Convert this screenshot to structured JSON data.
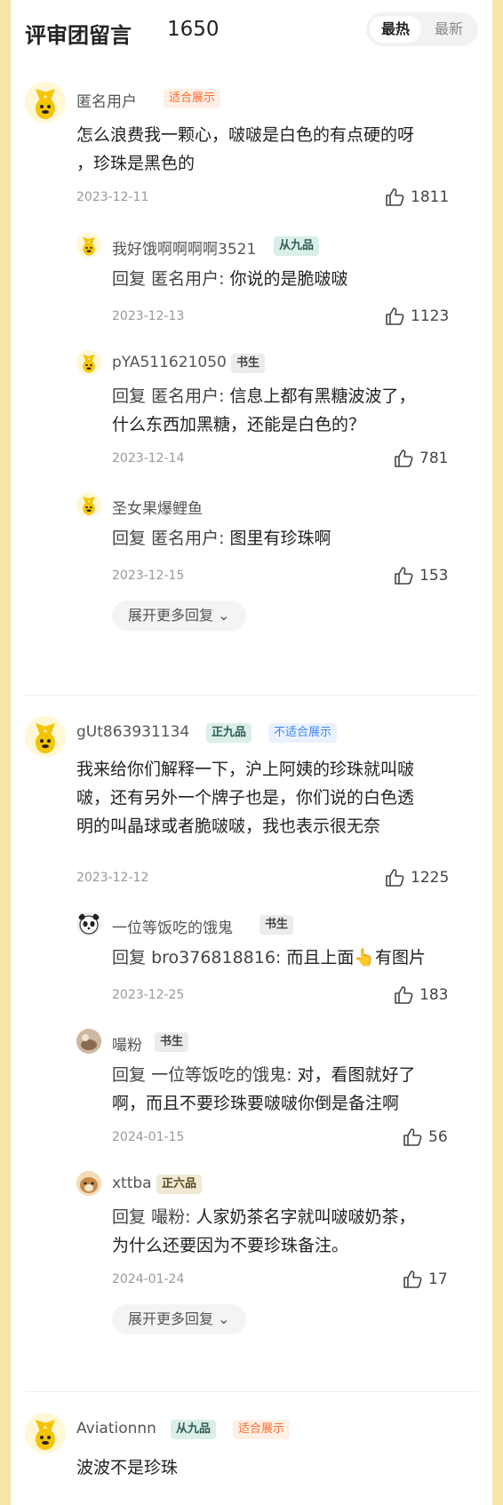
{
  "header": {
    "title": "评审团留言",
    "count": "1650",
    "sort_hot": "最热",
    "sort_new": "最新"
  },
  "threads": [
    {
      "user": "匿名用户",
      "tag": "适合展示",
      "text_line1": "怎么浪费我一颗心，啵啵是白色的有点硬的呀",
      "text_line2": "，珍珠是黑色的",
      "date": "2023-12-11",
      "likes": "1811",
      "replies": [
        {
          "user": "我好饿啊啊啊啊3521",
          "badge": "从九品",
          "prefix": "回复",
          "to": "匿名用户:",
          "line1": "你说的是脆啵啵",
          "line2": "",
          "date": "2023-12-13",
          "likes": "1123"
        },
        {
          "user": "pYA511621050",
          "badge": "书生",
          "prefix": "回复",
          "to": "匿名用户:",
          "line1": "信息上都有黑糖波波了，",
          "line2": "什么东西加黑糖，还能是白色的？",
          "date": "2023-12-14",
          "likes": "781"
        },
        {
          "user": "圣女果爆鲤鱼",
          "badge": "",
          "prefix": "回复",
          "to": "匿名用户:",
          "line1": "图里有珍珠啊",
          "line2": "",
          "date": "2023-12-15",
          "likes": "153"
        }
      ],
      "more": "展开更多回复"
    },
    {
      "user": "gUt863931134",
      "badge": "正九品",
      "tag": "不适合展示",
      "text_line1": "我来给你们解释一下，沪上阿姨的珍珠就叫啵",
      "text_line2": "啵，还有另外一个牌子也是，你们说的白色透",
      "text_line3": "明的叫晶球或者脆啵啵，我也表示很无奈",
      "date": "2023-12-12",
      "likes": "1225",
      "replies": [
        {
          "user": "一位等饭吃的饿鬼",
          "badge": "书生",
          "prefix": "回复",
          "to": "bro376818816:",
          "line1": "而且上面👆有图片",
          "line2": "",
          "date": "2023-12-25",
          "likes": "183"
        },
        {
          "user": "嘬粉",
          "badge": "书生",
          "prefix": "回复",
          "to": "一位等饭吃的饿鬼:",
          "line1": "对，看图就好了",
          "line2": "啊，而且不要珍珠要啵啵你倒是备注啊",
          "date": "2024-01-15",
          "likes": "56"
        },
        {
          "user": "xttba",
          "badge": "正六品",
          "prefix": "回复",
          "to": "嘬粉:",
          "line1": "人家奶茶名字就叫啵啵奶茶，",
          "line2": "为什么还要因为不要珍珠备注。",
          "date": "2024-01-24",
          "likes": "17"
        }
      ],
      "more": "展开更多回复"
    },
    {
      "user": "Aviationnn",
      "badge": "从九品",
      "tag": "适合展示",
      "text_line1": "波波不是珍珠"
    }
  ],
  "colors": {
    "accent_orange": "#ff6a2b",
    "accent_blue": "#3f86f5",
    "page_bg": "#f6e7a8"
  }
}
